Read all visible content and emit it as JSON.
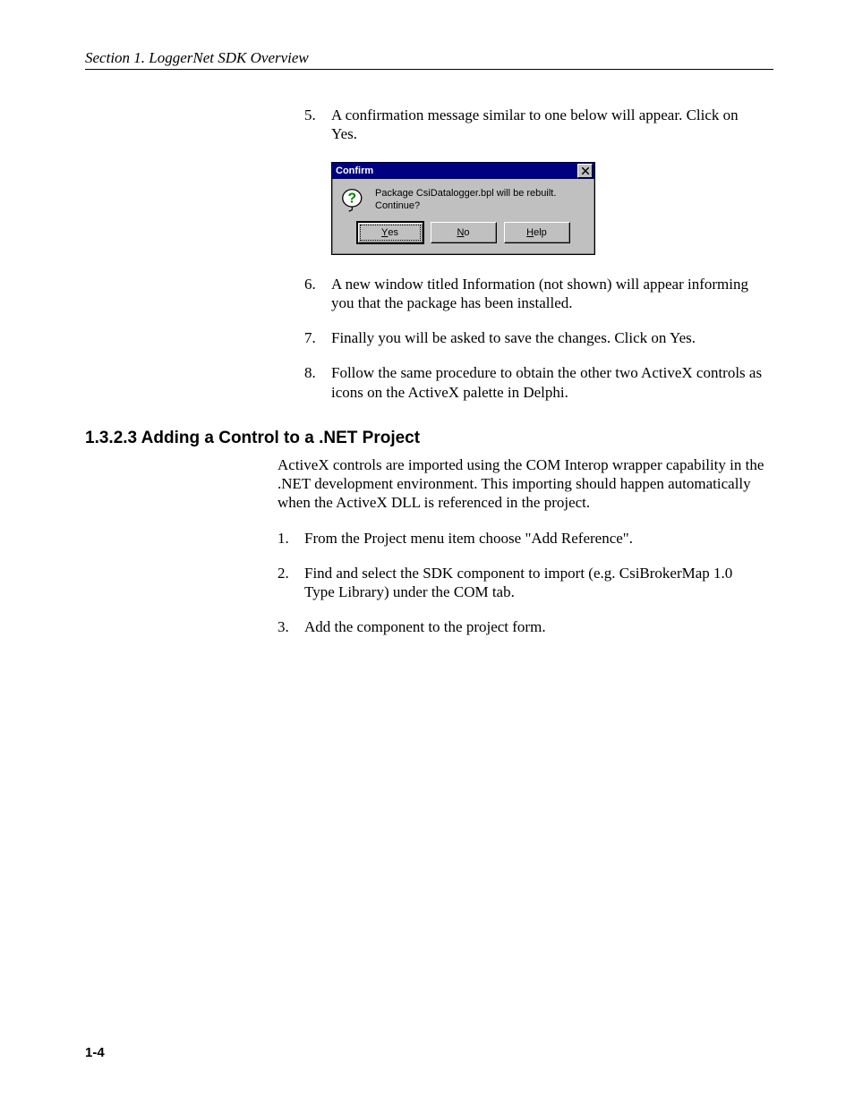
{
  "header": {
    "title": "Section 1.  LoggerNet SDK Overview"
  },
  "steps_a": [
    {
      "n": "5.",
      "t": "A confirmation message similar to one below will appear. Click on Yes."
    }
  ],
  "dialog": {
    "title": "Confirm",
    "message": "Package CsiDatalogger.bpl will be rebuilt.  Continue?",
    "buttons": {
      "yes_pre": "",
      "yes_u": "Y",
      "yes_post": "es",
      "no_pre": "",
      "no_u": "N",
      "no_post": "o",
      "help_pre": "",
      "help_u": "H",
      "help_post": "elp"
    }
  },
  "steps_b": [
    {
      "n": "6.",
      "t": "A new window titled Information (not shown) will appear informing you that the package has been installed."
    },
    {
      "n": "7.",
      "t": "Finally you will be asked to save the changes.  Click on Yes."
    },
    {
      "n": "8.",
      "t": "Follow the same procedure to obtain the other two ActiveX controls as icons on the ActiveX palette in Delphi."
    }
  ],
  "section": {
    "heading": "1.3.2.3  Adding a Control to a .NET Project",
    "para": "ActiveX controls are imported using the COM Interop wrapper capability in the .NET development environment.  This importing should happen automatically when the ActiveX DLL is referenced in the project.",
    "steps": [
      {
        "n": "1.",
        "t": "From the Project menu item choose \"Add Reference\"."
      },
      {
        "n": "2.",
        "t": "Find and select the SDK component to import (e.g. CsiBrokerMap 1.0 Type Library) under the COM tab."
      },
      {
        "n": "3.",
        "t": "Add the component to the project form."
      }
    ]
  },
  "page_number": "1-4"
}
